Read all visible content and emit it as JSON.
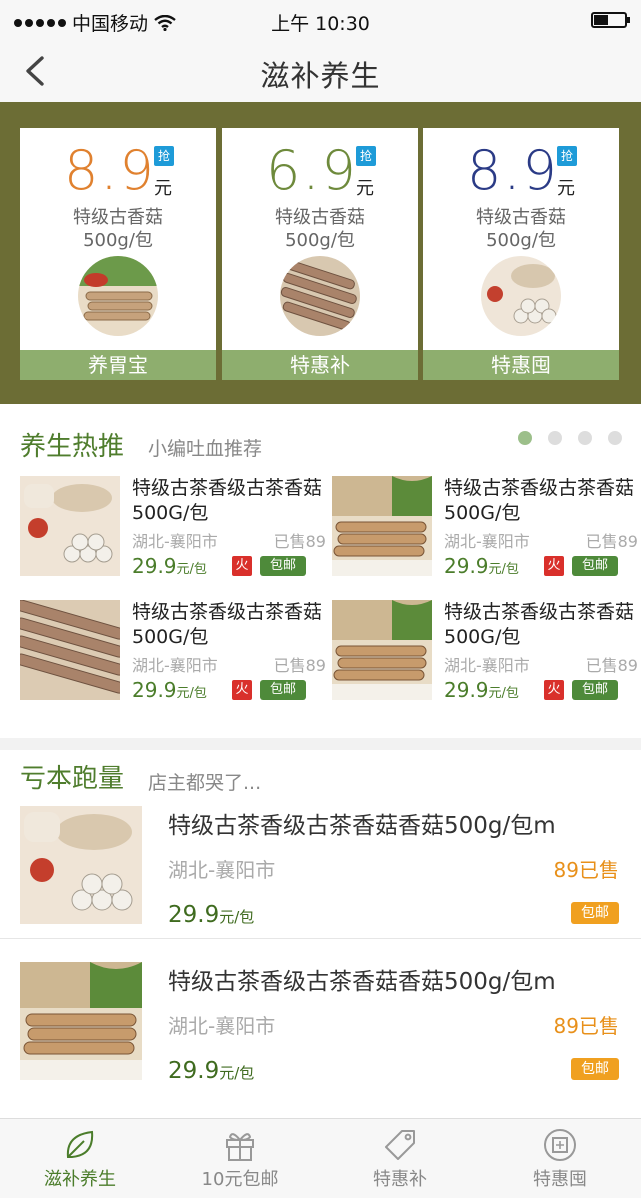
{
  "status_bar": {
    "carrier": "中国移动",
    "time": "上午 10:30"
  },
  "nav": {
    "title": "滋补养生"
  },
  "promos": [
    {
      "price": "8.9",
      "grab": "抢",
      "unit": "元",
      "name": "特级古香菇",
      "spec": "500g/包",
      "tag": "养胃宝",
      "color": "#e0812f"
    },
    {
      "price": "6.9",
      "grab": "抢",
      "unit": "元",
      "name": "特级古香菇",
      "spec": "500g/包",
      "tag": "特惠补",
      "color": "#6e8a3c"
    },
    {
      "price": "8.9",
      "grab": "抢",
      "unit": "元",
      "name": "特级古香菇",
      "spec": "500g/包",
      "tag": "特惠囤",
      "color": "#2b3b86"
    }
  ],
  "hot": {
    "title": "养生热推",
    "subtitle": "小编吐血推荐",
    "items": [
      {
        "name": "特级古茶香级古茶香菇500G/包",
        "location": "湖北-襄阳市",
        "sold": "已售89",
        "price": "29.9",
        "unit": "元/包",
        "fire": "火",
        "shipping": "包邮"
      },
      {
        "name": "特级古茶香级古茶香菇500G/包",
        "location": "湖北-襄阳市",
        "sold": "已售89",
        "price": "29.9",
        "unit": "元/包",
        "fire": "火",
        "shipping": "包邮"
      },
      {
        "name": "特级古茶香级古茶香菇500G/包",
        "location": "湖北-襄阳市",
        "sold": "已售89",
        "price": "29.9",
        "unit": "元/包",
        "fire": "火",
        "shipping": "包邮"
      },
      {
        "name": "特级古茶香级古茶香菇500G/包",
        "location": "湖北-襄阳市",
        "sold": "已售89",
        "price": "29.9",
        "unit": "元/包",
        "fire": "火",
        "shipping": "包邮"
      }
    ]
  },
  "loss": {
    "title": "亏本跑量",
    "subtitle": "店主都哭了...",
    "items": [
      {
        "name": "特级古茶香级古茶香菇香菇500g/包m",
        "location": "湖北-襄阳市",
        "sold": "89已售",
        "price": "29.9",
        "unit": "元/包",
        "shipping": "包邮"
      },
      {
        "name": "特级古茶香级古茶香菇香菇500g/包m",
        "location": "湖北-襄阳市",
        "sold": "89已售",
        "price": "29.9",
        "unit": "元/包",
        "shipping": "包邮"
      }
    ]
  },
  "tabs": [
    {
      "label": "滋补养生",
      "icon": "leaf-icon"
    },
    {
      "label": "10元包邮",
      "icon": "gift-icon"
    },
    {
      "label": "特惠补",
      "icon": "tag-icon"
    },
    {
      "label": "特惠囤",
      "icon": "stamp-icon"
    }
  ]
}
